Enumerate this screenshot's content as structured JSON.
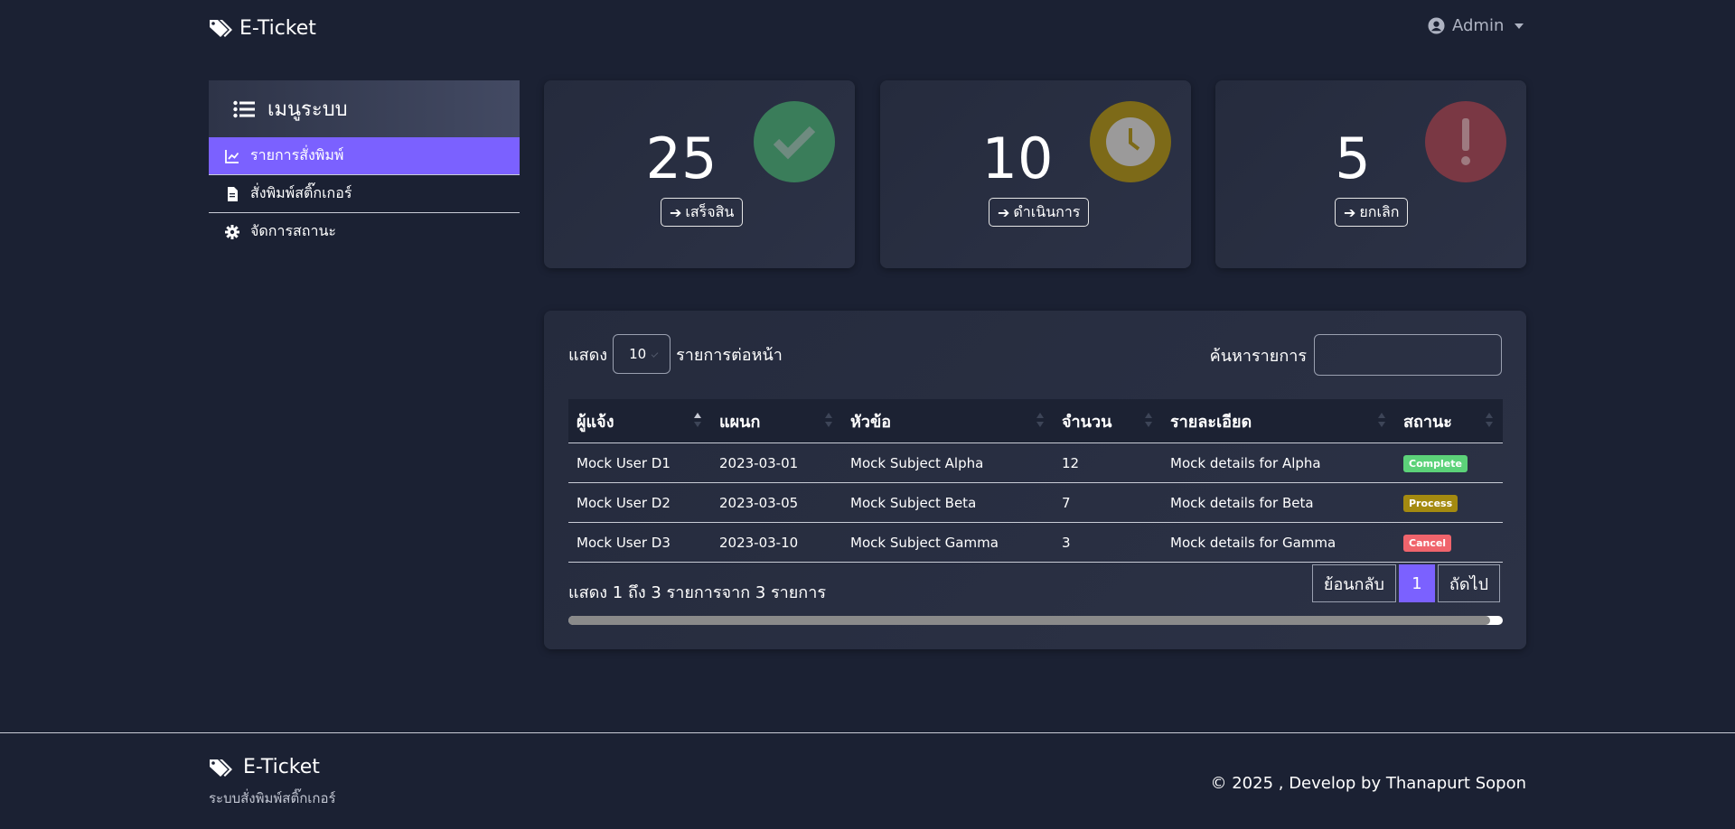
{
  "navbar": {
    "brand": "E-Ticket",
    "user": "Admin"
  },
  "sidebar": {
    "title": "เมนูระบบ",
    "items": [
      {
        "label": "รายการสั่งพิมพ์",
        "icon": "chart-line-icon",
        "active": true
      },
      {
        "label": "สั่งพิมพ์สติ๊กเกอร์",
        "icon": "file-icon",
        "active": false
      },
      {
        "label": "จัดการสถานะ",
        "icon": "gear-icon",
        "active": false
      }
    ]
  },
  "stats": [
    {
      "value": "25",
      "button": "เสร็จสิน",
      "icon": "check-icon",
      "color": "#3a7d5a"
    },
    {
      "value": "10",
      "button": "ดำเนินการ",
      "icon": "clock-icon",
      "color": "#7d6a18"
    },
    {
      "value": "5",
      "button": "ยกเลิก",
      "icon": "exclamation-icon",
      "color": "#7a3844"
    }
  ],
  "table_controls": {
    "show_label": "แสดง",
    "page_length": "10",
    "per_page_label": "รายการต่อหน้า",
    "search_label": "ค้นหารายการ",
    "search_value": ""
  },
  "table": {
    "columns": [
      "ผู้แจ้ง",
      "แผนก",
      "หัวข้อ",
      "จำนวน",
      "รายละเอียด",
      "สถานะ"
    ],
    "rows": [
      {
        "reporter": "Mock User D1",
        "department": "2023-03-01",
        "subject": "Mock Subject Alpha",
        "qty": "12",
        "details": "Mock details for Alpha",
        "status": "Complete",
        "status_color": "#5cd279"
      },
      {
        "reporter": "Mock User D2",
        "department": "2023-03-05",
        "subject": "Mock Subject Beta",
        "qty": "7",
        "details": "Mock details for Beta",
        "status": "Process",
        "status_color": "#a48a10"
      },
      {
        "reporter": "Mock User D3",
        "department": "2023-03-10",
        "subject": "Mock Subject Gamma",
        "qty": "3",
        "details": "Mock details for Gamma",
        "status": "Cancel",
        "status_color": "#f0646c"
      }
    ]
  },
  "pagination": {
    "info": "แสดง 1 ถึง 3 รายการจาก 3 รายการ",
    "prev": "ย้อนกลับ",
    "current": "1",
    "next": "ถัดไป"
  },
  "footer": {
    "brand": "E-Ticket",
    "subtitle": "ระบบสั่งพิมพ์สติ๊กเกอร์",
    "copyright": "© 2025 , Develop by Thanapurt Sopon"
  }
}
